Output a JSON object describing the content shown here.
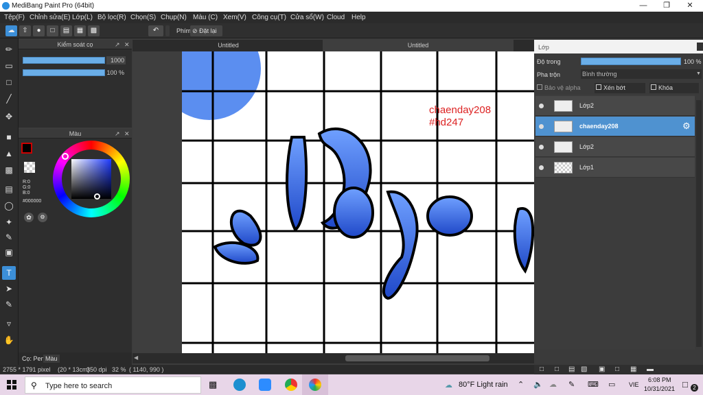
{
  "window": {
    "title": "MediBang Paint Pro (64bit)"
  },
  "menu": [
    "Tệp(F)",
    "Chỉnh sửa(E)",
    "Lớp(L)",
    "Bộ lọc(R)",
    "Chọn(S)",
    "Chụp(N)",
    "Màu (C)",
    "Xem(V)",
    "Công cụ(T)",
    "Cửa sổ(W)",
    "Cloud",
    "Help"
  ],
  "toolbar": {
    "key_label": "Phím",
    "reset_label": "Đặt lại"
  },
  "brush_panel": {
    "title": "Kiểm soát cọ",
    "size_value": "1000",
    "opacity_value": "100 %"
  },
  "color_panel": {
    "title": "Màu",
    "r": "R:0",
    "g": "G:0",
    "b": "B:0",
    "hex": "#000000"
  },
  "left_tabs": {
    "pen": "Cọ: Pen",
    "color": "Màu"
  },
  "doc_tabs": [
    "Untitled",
    "Untitled"
  ],
  "canvas": {
    "watermark_line1": "chaenday208",
    "watermark_line2": "#hd247"
  },
  "status": {
    "size": "2755 * 1791 pixel",
    "cm": "(20 * 13cm)",
    "dpi": "350 dpi",
    "zoom": "32 %",
    "coords": "( 1140, 990 )"
  },
  "layer_panel": {
    "title": "Lớp",
    "opacity_label": "Độ trong",
    "opacity_value": "100 %",
    "blend_label": "Pha trộn",
    "blend_value": "Bình thường",
    "protect_alpha": "Bảo vệ alpha",
    "clipping": "Xén bớt",
    "lock": "Khóa",
    "layers": [
      {
        "name": "Lớp2",
        "selected": false
      },
      {
        "name": "chaenday208",
        "selected": true
      },
      {
        "name": "Lớp2",
        "selected": false
      },
      {
        "name": "Lớp1",
        "selected": false
      }
    ]
  },
  "taskbar": {
    "search_placeholder": "Type here to search",
    "weather": "80°F  Light rain",
    "lang": "VIE",
    "time": "6:08 PM",
    "date": "10/31/2021",
    "notifications": "2"
  }
}
